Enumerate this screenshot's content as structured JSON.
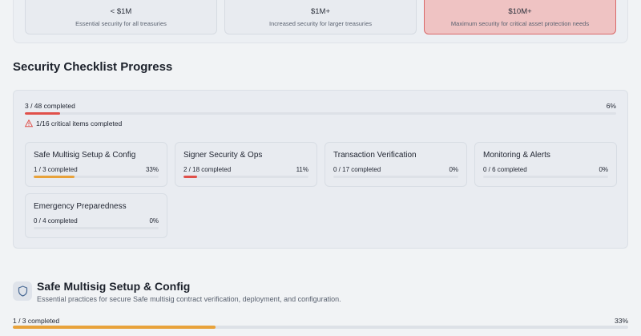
{
  "tiers": [
    {
      "amount": "< $1M",
      "description": "Essential security for all treasuries"
    },
    {
      "amount": "$1M+",
      "description": "Increased security for larger treasuries"
    },
    {
      "amount": "$10M+",
      "description": "Maximum security for critical asset protection needs"
    }
  ],
  "checklist": {
    "title": "Security Checklist Progress",
    "overall_label": "3 / 48 completed",
    "overall_pct": "6%",
    "overall_fraction": 0.06,
    "critical_label": "1/16 critical items completed",
    "categories": [
      {
        "name": "Safe Multisig Setup & Config",
        "count": "1 / 3 completed",
        "pct": "33%",
        "fraction": 0.33,
        "color": "#e8a23a"
      },
      {
        "name": "Signer Security & Ops",
        "count": "2 / 18 completed",
        "pct": "11%",
        "fraction": 0.11,
        "color": "#e0504a"
      },
      {
        "name": "Transaction Verification",
        "count": "0 / 17 completed",
        "pct": "0%",
        "fraction": 0,
        "color": "#e0504a"
      },
      {
        "name": "Monitoring & Alerts",
        "count": "0 / 6 completed",
        "pct": "0%",
        "fraction": 0,
        "color": "#e0504a"
      },
      {
        "name": "Emergency Preparedness",
        "count": "0 / 4 completed",
        "pct": "0%",
        "fraction": 0,
        "color": "#e0504a"
      }
    ]
  },
  "section": {
    "icon": "shield-icon",
    "title": "Safe Multisig Setup & Config",
    "description": "Essential practices for secure Safe multisig contract verification, deployment, and configuration.",
    "count": "1 / 3 completed",
    "pct": "33%",
    "fraction": 0.33,
    "color": "#e8a23a"
  },
  "colors": {
    "danger": "#e0504a",
    "warning": "#e8a23a",
    "highlight_bg": "#efc3c3"
  }
}
